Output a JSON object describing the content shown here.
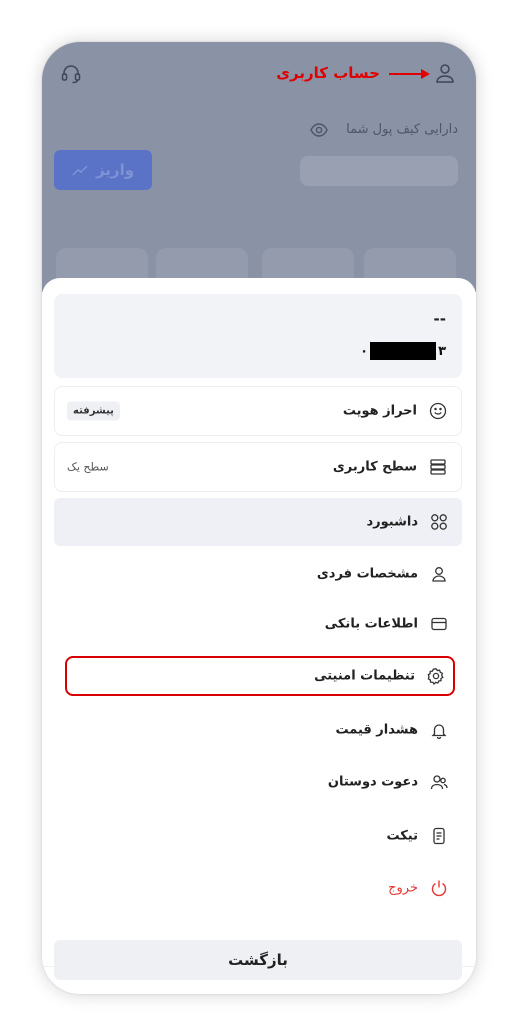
{
  "header": {
    "account_label": "حساب کاربری",
    "user_icon": "user-icon",
    "support_icon": "headset-icon"
  },
  "wallet": {
    "label": "دارایی کیف پول شما",
    "eye_icon": "eye-icon",
    "deposit_label": "واریز"
  },
  "profile": {
    "name": "--",
    "phone_start": "۳",
    "phone_end": "۰"
  },
  "verification": {
    "label": "احراز هویت",
    "badge": "پیشرفته",
    "icon": "smile-icon"
  },
  "user_level": {
    "label": "سطح کاربری",
    "value": "سطح یک",
    "icon": "layers-icon"
  },
  "menu": {
    "dashboard": "داشبورد",
    "personal_info": "مشخصات فردی",
    "bank_info": "اطلاعات بانکی",
    "security_settings": "تنظیمات امنیتی",
    "price_alert": "هشدار قیمت",
    "invite_friends": "دعوت دوستان",
    "ticket": "تیکت",
    "logout": "خروج"
  },
  "back_label": "بازگشت",
  "colors": {
    "overlay": "#8a93a6",
    "annotation_red": "#e10000",
    "logout_red": "#e53935",
    "deposit_button": "#5b73c7"
  }
}
